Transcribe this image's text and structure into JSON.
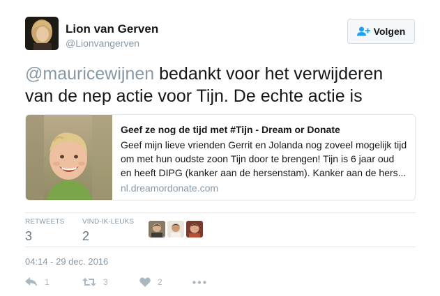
{
  "author": {
    "name": "Lion van Gerven",
    "handle": "@Lionvangerven"
  },
  "follow_button": {
    "label": "Volgen",
    "icon": "add-user-icon"
  },
  "tweet": {
    "mention": "@mauricewijnen",
    "text_line1_rest": " bedankt voor het verwijderen",
    "text_line2": "van de nep actie voor Tijn. De echte actie is"
  },
  "card": {
    "title": "Geef ze nog de tijd met #Tijn - Dream or Donate",
    "description_lines": [
      "Geef mijn lieve vrienden Gerrit en Jolanda nog zoveel mogelijk tijd",
      "om met hun oudste zoon Tijn door te brengen! Tijn is 6 jaar oud",
      "en heeft DIPG (kanker aan de hersenstam). Kanker aan de hers..."
    ],
    "domain": "nl.dreamordonate.com"
  },
  "stats": {
    "retweets_label": "RETWEETS",
    "retweets_value": "3",
    "likes_label": "VIND-IK-LEUKS",
    "likes_value": "2"
  },
  "timestamp": "04:14 - 29 dec. 2016",
  "actions": {
    "reply_count": "1",
    "retweet_count": "3",
    "like_count": "2"
  },
  "colors": {
    "text": "#14171a",
    "muted": "#8899a6",
    "action_icon": "#aab8c2",
    "border": "#e1e8ed",
    "follow_icon": "#1da1f2"
  }
}
